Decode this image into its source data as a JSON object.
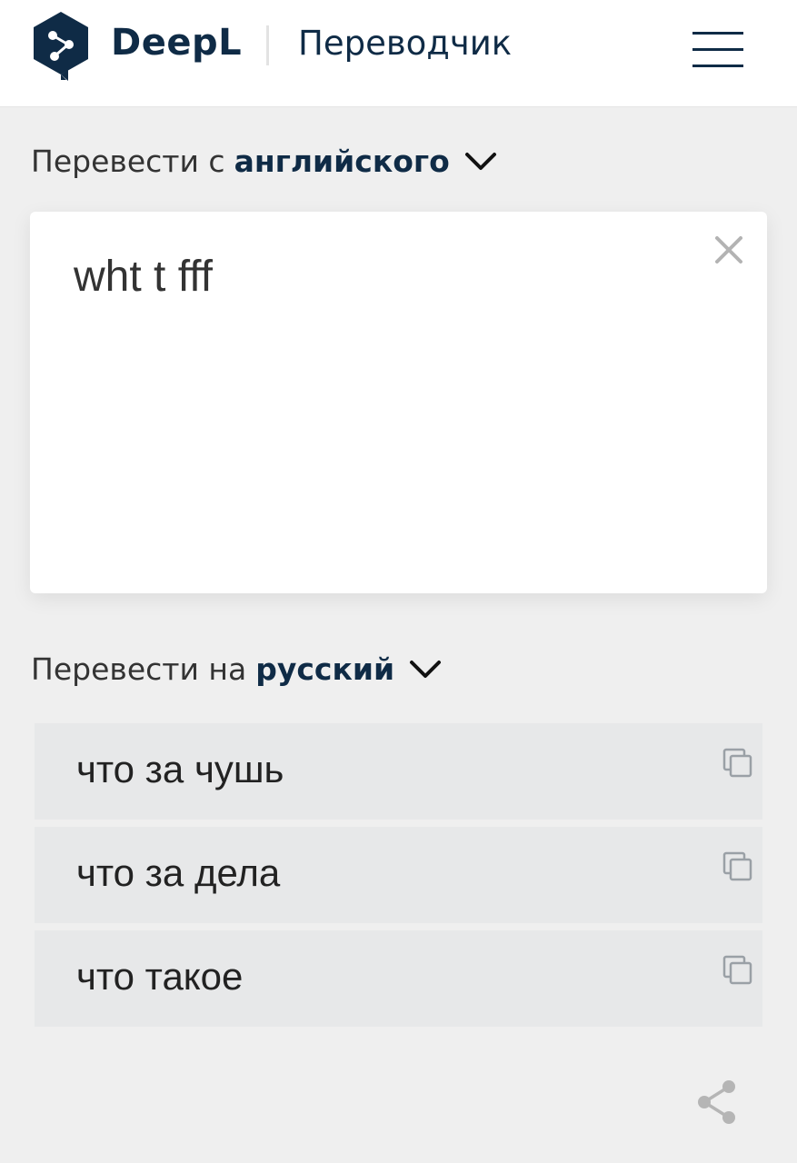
{
  "header": {
    "brand": "DeepL",
    "subtitle": "Переводчик",
    "logo_icon": "deepl-logo-icon",
    "menu_icon": "hamburger-menu-icon",
    "brand_color": "#0f2b46"
  },
  "source": {
    "label_prefix": "Перевести с",
    "language": "английского",
    "text": "wht t fff",
    "clear_icon": "close-icon"
  },
  "target": {
    "label_prefix": "Перевести на",
    "language": "русский",
    "alternatives": [
      {
        "text": "что за чушь",
        "icon": "copy-icon"
      },
      {
        "text": "что за дела",
        "icon": "copy-icon"
      },
      {
        "text": "что такое",
        "icon": "copy-icon"
      }
    ]
  },
  "footer": {
    "share_icon": "share-icon"
  },
  "colors": {
    "background": "#efefef",
    "card": "#ffffff",
    "result_bg": "#e7e8e9",
    "accent": "#0f2b46",
    "icon_gray": "#9aa0a6"
  }
}
